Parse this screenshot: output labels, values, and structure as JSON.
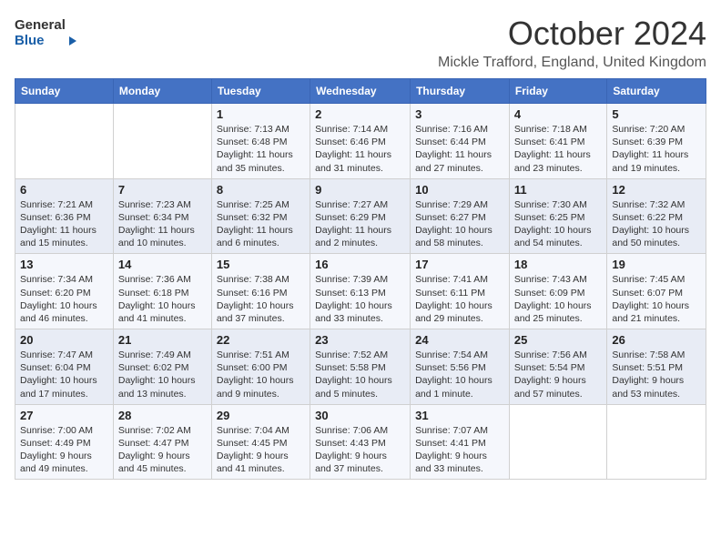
{
  "logo": {
    "general": "General",
    "blue": "Blue"
  },
  "title": "October 2024",
  "location": "Mickle Trafford, England, United Kingdom",
  "days_of_week": [
    "Sunday",
    "Monday",
    "Tuesday",
    "Wednesday",
    "Thursday",
    "Friday",
    "Saturday"
  ],
  "weeks": [
    [
      {
        "day": "",
        "info": ""
      },
      {
        "day": "",
        "info": ""
      },
      {
        "day": "1",
        "info": "Sunrise: 7:13 AM\nSunset: 6:48 PM\nDaylight: 11 hours and 35 minutes."
      },
      {
        "day": "2",
        "info": "Sunrise: 7:14 AM\nSunset: 6:46 PM\nDaylight: 11 hours and 31 minutes."
      },
      {
        "day": "3",
        "info": "Sunrise: 7:16 AM\nSunset: 6:44 PM\nDaylight: 11 hours and 27 minutes."
      },
      {
        "day": "4",
        "info": "Sunrise: 7:18 AM\nSunset: 6:41 PM\nDaylight: 11 hours and 23 minutes."
      },
      {
        "day": "5",
        "info": "Sunrise: 7:20 AM\nSunset: 6:39 PM\nDaylight: 11 hours and 19 minutes."
      }
    ],
    [
      {
        "day": "6",
        "info": "Sunrise: 7:21 AM\nSunset: 6:36 PM\nDaylight: 11 hours and 15 minutes."
      },
      {
        "day": "7",
        "info": "Sunrise: 7:23 AM\nSunset: 6:34 PM\nDaylight: 11 hours and 10 minutes."
      },
      {
        "day": "8",
        "info": "Sunrise: 7:25 AM\nSunset: 6:32 PM\nDaylight: 11 hours and 6 minutes."
      },
      {
        "day": "9",
        "info": "Sunrise: 7:27 AM\nSunset: 6:29 PM\nDaylight: 11 hours and 2 minutes."
      },
      {
        "day": "10",
        "info": "Sunrise: 7:29 AM\nSunset: 6:27 PM\nDaylight: 10 hours and 58 minutes."
      },
      {
        "day": "11",
        "info": "Sunrise: 7:30 AM\nSunset: 6:25 PM\nDaylight: 10 hours and 54 minutes."
      },
      {
        "day": "12",
        "info": "Sunrise: 7:32 AM\nSunset: 6:22 PM\nDaylight: 10 hours and 50 minutes."
      }
    ],
    [
      {
        "day": "13",
        "info": "Sunrise: 7:34 AM\nSunset: 6:20 PM\nDaylight: 10 hours and 46 minutes."
      },
      {
        "day": "14",
        "info": "Sunrise: 7:36 AM\nSunset: 6:18 PM\nDaylight: 10 hours and 41 minutes."
      },
      {
        "day": "15",
        "info": "Sunrise: 7:38 AM\nSunset: 6:16 PM\nDaylight: 10 hours and 37 minutes."
      },
      {
        "day": "16",
        "info": "Sunrise: 7:39 AM\nSunset: 6:13 PM\nDaylight: 10 hours and 33 minutes."
      },
      {
        "day": "17",
        "info": "Sunrise: 7:41 AM\nSunset: 6:11 PM\nDaylight: 10 hours and 29 minutes."
      },
      {
        "day": "18",
        "info": "Sunrise: 7:43 AM\nSunset: 6:09 PM\nDaylight: 10 hours and 25 minutes."
      },
      {
        "day": "19",
        "info": "Sunrise: 7:45 AM\nSunset: 6:07 PM\nDaylight: 10 hours and 21 minutes."
      }
    ],
    [
      {
        "day": "20",
        "info": "Sunrise: 7:47 AM\nSunset: 6:04 PM\nDaylight: 10 hours and 17 minutes."
      },
      {
        "day": "21",
        "info": "Sunrise: 7:49 AM\nSunset: 6:02 PM\nDaylight: 10 hours and 13 minutes."
      },
      {
        "day": "22",
        "info": "Sunrise: 7:51 AM\nSunset: 6:00 PM\nDaylight: 10 hours and 9 minutes."
      },
      {
        "day": "23",
        "info": "Sunrise: 7:52 AM\nSunset: 5:58 PM\nDaylight: 10 hours and 5 minutes."
      },
      {
        "day": "24",
        "info": "Sunrise: 7:54 AM\nSunset: 5:56 PM\nDaylight: 10 hours and 1 minute."
      },
      {
        "day": "25",
        "info": "Sunrise: 7:56 AM\nSunset: 5:54 PM\nDaylight: 9 hours and 57 minutes."
      },
      {
        "day": "26",
        "info": "Sunrise: 7:58 AM\nSunset: 5:51 PM\nDaylight: 9 hours and 53 minutes."
      }
    ],
    [
      {
        "day": "27",
        "info": "Sunrise: 7:00 AM\nSunset: 4:49 PM\nDaylight: 9 hours and 49 minutes."
      },
      {
        "day": "28",
        "info": "Sunrise: 7:02 AM\nSunset: 4:47 PM\nDaylight: 9 hours and 45 minutes."
      },
      {
        "day": "29",
        "info": "Sunrise: 7:04 AM\nSunset: 4:45 PM\nDaylight: 9 hours and 41 minutes."
      },
      {
        "day": "30",
        "info": "Sunrise: 7:06 AM\nSunset: 4:43 PM\nDaylight: 9 hours and 37 minutes."
      },
      {
        "day": "31",
        "info": "Sunrise: 7:07 AM\nSunset: 4:41 PM\nDaylight: 9 hours and 33 minutes."
      },
      {
        "day": "",
        "info": ""
      },
      {
        "day": "",
        "info": ""
      }
    ]
  ]
}
